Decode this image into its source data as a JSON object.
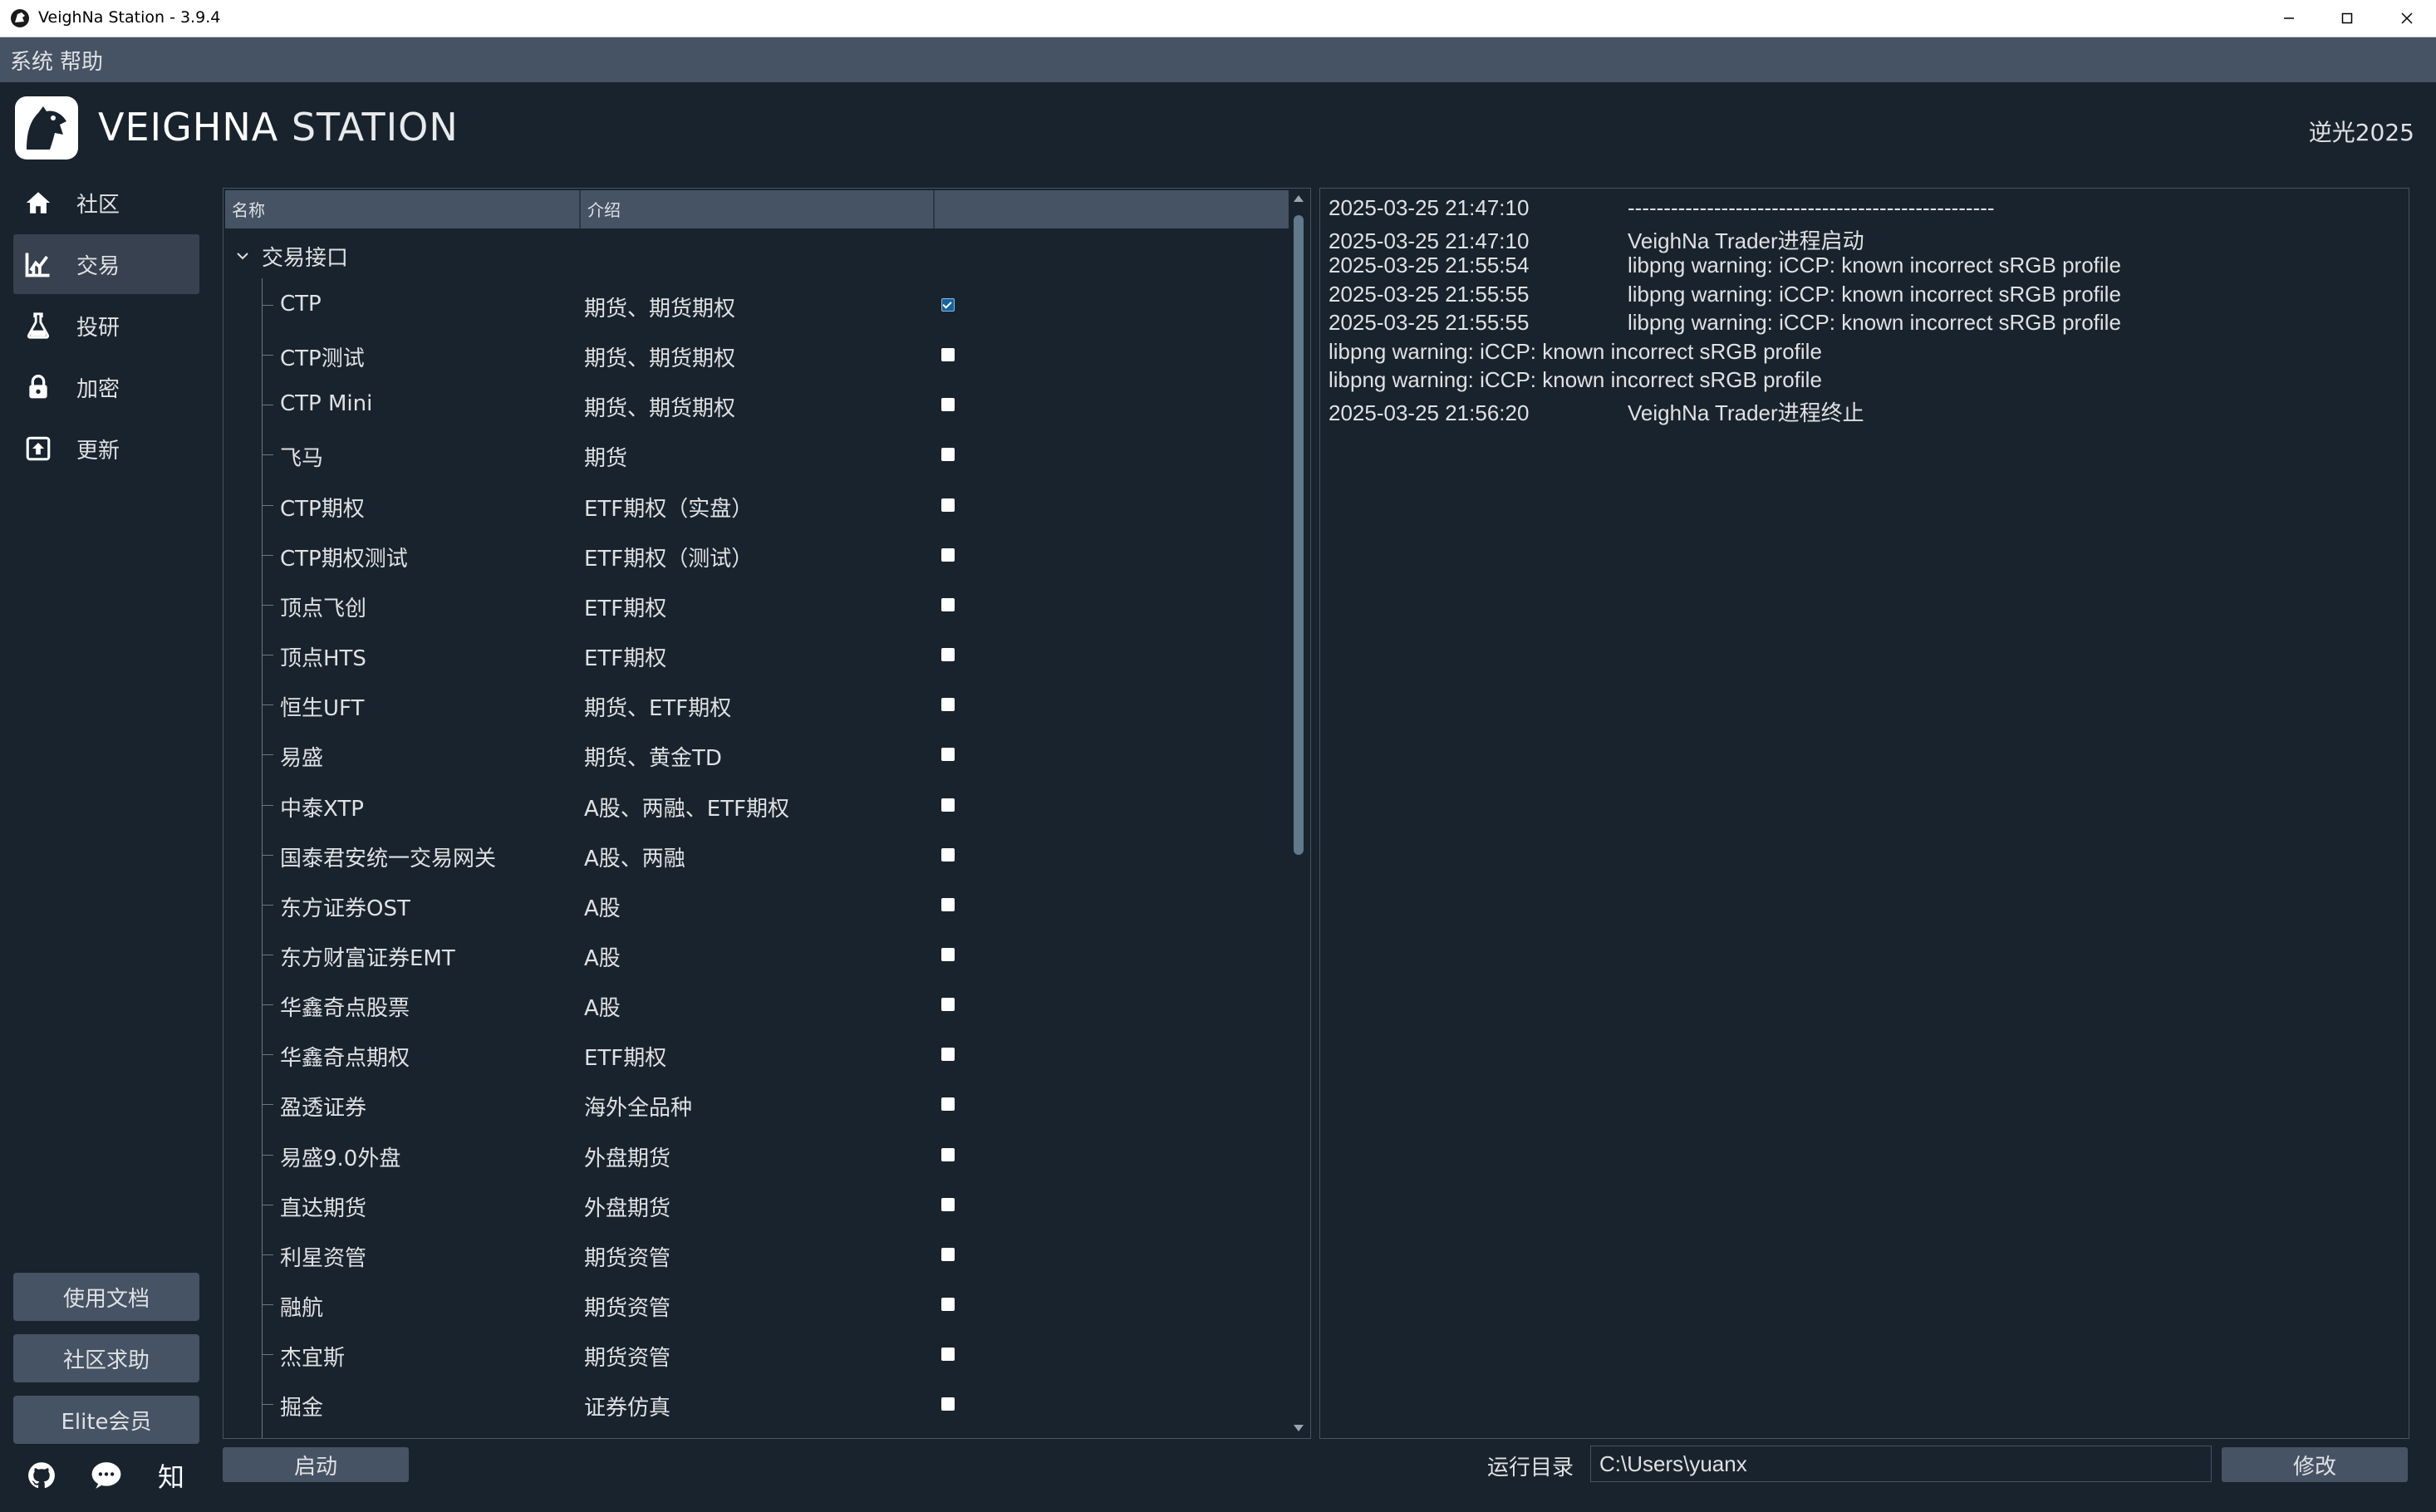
{
  "window": {
    "title": "VeighNa Station - 3.9.4",
    "icons": [
      "app-logo-icon",
      "minimize-icon",
      "maximize-icon",
      "close-icon"
    ]
  },
  "menu": {
    "items": [
      "系统",
      "帮助"
    ]
  },
  "header": {
    "brand_bold": "VEIGHNA",
    "brand_light": "STATION",
    "edition": "逆光2025"
  },
  "sidebar": {
    "items": [
      {
        "label": "社区",
        "icon": "home-icon",
        "active": false
      },
      {
        "label": "交易",
        "icon": "chart-icon",
        "active": true
      },
      {
        "label": "投研",
        "icon": "flask-icon",
        "active": false
      },
      {
        "label": "加密",
        "icon": "lock-icon",
        "active": false
      },
      {
        "label": "更新",
        "icon": "upload-icon",
        "active": false
      }
    ],
    "buttons": [
      "使用文档",
      "社区求助",
      "Elite会员"
    ],
    "social_icons": [
      "github-icon",
      "wechat-icon",
      "zhihu-icon"
    ],
    "zhihu_glyph": "知"
  },
  "apps": {
    "columns": [
      "名称",
      "介绍",
      ""
    ],
    "group": "交易接口",
    "rows": [
      {
        "name": "CTP",
        "intro": "期货、期货期权",
        "checked": true
      },
      {
        "name": "CTP测试",
        "intro": "期货、期货期权",
        "checked": false
      },
      {
        "name": "CTP Mini",
        "intro": "期货、期货期权",
        "checked": false
      },
      {
        "name": "飞马",
        "intro": "期货",
        "checked": false
      },
      {
        "name": "CTP期权",
        "intro": "ETF期权（实盘）",
        "checked": false
      },
      {
        "name": "CTP期权测试",
        "intro": "ETF期权（测试）",
        "checked": false
      },
      {
        "name": "顶点飞创",
        "intro": "ETF期权",
        "checked": false
      },
      {
        "name": "顶点HTS",
        "intro": "ETF期权",
        "checked": false
      },
      {
        "name": "恒生UFT",
        "intro": "期货、ETF期权",
        "checked": false
      },
      {
        "name": "易盛",
        "intro": "期货、黄金TD",
        "checked": false
      },
      {
        "name": "中泰XTP",
        "intro": "A股、两融、ETF期权",
        "checked": false
      },
      {
        "name": "国泰君安统一交易网关",
        "intro": "A股、两融",
        "checked": false
      },
      {
        "name": "东方证券OST",
        "intro": "A股",
        "checked": false
      },
      {
        "name": "东方财富证券EMT",
        "intro": "A股",
        "checked": false
      },
      {
        "name": "华鑫奇点股票",
        "intro": "A股",
        "checked": false
      },
      {
        "name": "华鑫奇点期权",
        "intro": "ETF期权",
        "checked": false
      },
      {
        "name": "盈透证券",
        "intro": "海外全品种",
        "checked": false
      },
      {
        "name": "易盛9.0外盘",
        "intro": "外盘期货",
        "checked": false
      },
      {
        "name": "直达期货",
        "intro": "外盘期货",
        "checked": false
      },
      {
        "name": "利星资管",
        "intro": "期货资管",
        "checked": false
      },
      {
        "name": "融航",
        "intro": "期货资管",
        "checked": false
      },
      {
        "name": "杰宜斯",
        "intro": "期货资管",
        "checked": false
      },
      {
        "name": "掘金",
        "intro": "证券仿真",
        "checked": false
      }
    ]
  },
  "log": {
    "lines": [
      {
        "time": "2025-03-25 21:47:10",
        "msg": "---------------------------------------------------"
      },
      {
        "time": "2025-03-25 21:47:10",
        "msg": "VeighNa Trader进程启动"
      },
      {
        "time": "2025-03-25 21:55:54",
        "msg": "libpng warning: iCCP: known incorrect sRGB profile"
      },
      {
        "time": "2025-03-25 21:55:55",
        "msg": "libpng warning: iCCP: known incorrect sRGB profile"
      },
      {
        "time": "2025-03-25 21:55:55",
        "msg": "libpng warning: iCCP: known incorrect sRGB profile"
      },
      {
        "time": "",
        "msg": "libpng warning: iCCP: known incorrect sRGB profile"
      },
      {
        "time": "",
        "msg": "libpng warning: iCCP: known incorrect sRGB profile"
      },
      {
        "time": "2025-03-25 21:56:20",
        "msg": "VeighNa Trader进程终止"
      }
    ]
  },
  "bottom": {
    "start_label": "启动",
    "rundir_label": "运行目录",
    "rundir_value": "C:\\Users\\yuanx",
    "modify_label": "修改"
  },
  "colors": {
    "background": "#19232d",
    "panel_header": "#455364",
    "active_nav": "#37414f",
    "accent": "#1464a0",
    "text": "#e0e1e3"
  }
}
